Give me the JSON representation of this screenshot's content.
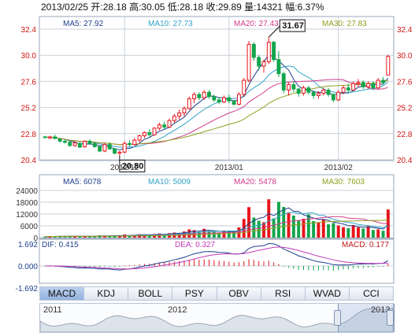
{
  "header": {
    "summary": "2013/02/25 开:28.18 高:30.05 低:28.18 收:29.89 量:14321 幅:6.37%"
  },
  "price_legend": [
    {
      "label": "MA5: 27.92",
      "color": "#1f3f8c"
    },
    {
      "label": "MA10: 27.73",
      "color": "#31a3c6"
    },
    {
      "label": "MA20: 27.43",
      "color": "#d23c8c"
    },
    {
      "label": "MA30: 27.83",
      "color": "#8fa020"
    }
  ],
  "volume_legend": [
    {
      "label": "MA5: 6078",
      "color": "#1f3f8c"
    },
    {
      "label": "MA10: 5009",
      "color": "#31a3c6"
    },
    {
      "label": "MA20: 5478",
      "color": "#d23c8c"
    },
    {
      "label": "MA30: 7603",
      "color": "#8fa020"
    }
  ],
  "macd_legend": {
    "dif": "DIF: 0.415",
    "dea": "DEA: 0.327",
    "macd": "MACD: 0.177"
  },
  "price_axis": {
    "ticks": [
      "32.4",
      "30.0",
      "27.6",
      "25.2",
      "22.8",
      "20.4"
    ],
    "values": [
      32.4,
      30.0,
      27.6,
      25.2,
      22.8,
      20.4
    ]
  },
  "volume_axis": {
    "ticks": [
      "24000",
      "18000",
      "12000",
      "6000",
      "0"
    ],
    "values": [
      24000,
      18000,
      12000,
      6000,
      0
    ]
  },
  "macd_axis": {
    "ticks": [
      "1.692",
      "0.000",
      "-1.692"
    ],
    "values": [
      1.692,
      0,
      -1.692
    ]
  },
  "date_labels": [
    "2012/12",
    "2013/01",
    "2013/02"
  ],
  "annotations": {
    "high": "31.67",
    "low": "20.80"
  },
  "tabs": [
    "MACD",
    "KDJ",
    "BOLL",
    "PSY",
    "OBV",
    "RSI",
    "WVAD",
    "CCI"
  ],
  "active_tab": "MACD",
  "navigator": {
    "years": [
      "2011",
      "2012",
      "2013"
    ]
  },
  "colors": {
    "up": "#e8141a",
    "down": "#13a54b",
    "grid": "#c9d0d8",
    "axis_up": "#d01515"
  },
  "chart_data": {
    "type": "candlestick",
    "title": "",
    "date_range": [
      "2012-11-16",
      "2013-02-25"
    ],
    "ylim_price": [
      20.4,
      32.4
    ],
    "ylim_volume": [
      0,
      24000
    ],
    "ylim_macd": [
      -1.692,
      1.692
    ],
    "candles": [
      [
        22.5,
        22.6,
        22.4,
        22.45
      ],
      [
        22.4,
        22.6,
        22.3,
        22.5
      ],
      [
        22.5,
        22.7,
        22.3,
        22.35
      ],
      [
        22.3,
        22.4,
        22.0,
        22.1
      ],
      [
        22.1,
        22.3,
        21.9,
        22.0
      ],
      [
        22.0,
        22.1,
        21.6,
        21.7
      ],
      [
        21.7,
        22.1,
        21.6,
        21.95
      ],
      [
        21.9,
        22.0,
        21.5,
        21.55
      ],
      [
        21.6,
        22.2,
        21.5,
        22.1
      ],
      [
        22.1,
        22.3,
        21.8,
        21.9
      ],
      [
        21.9,
        22.0,
        21.5,
        21.6
      ],
      [
        21.6,
        21.7,
        21.1,
        21.2
      ],
      [
        21.2,
        21.9,
        21.1,
        21.8
      ],
      [
        21.8,
        22.0,
        21.3,
        21.4
      ],
      [
        21.4,
        21.5,
        20.9,
        21.0
      ],
      [
        21.0,
        21.2,
        20.8,
        21.1
      ],
      [
        21.1,
        22.1,
        21.0,
        21.9
      ],
      [
        21.9,
        22.2,
        21.6,
        21.8
      ],
      [
        21.8,
        22.4,
        21.7,
        22.2
      ],
      [
        22.2,
        22.7,
        22.0,
        22.6
      ],
      [
        22.6,
        23.0,
        22.4,
        22.9
      ],
      [
        22.9,
        23.2,
        22.5,
        22.7
      ],
      [
        22.7,
        23.4,
        22.6,
        23.3
      ],
      [
        23.3,
        23.8,
        23.1,
        23.6
      ],
      [
        23.6,
        23.9,
        23.2,
        23.4
      ],
      [
        23.4,
        24.2,
        23.3,
        24.0
      ],
      [
        24.0,
        24.6,
        23.8,
        24.4
      ],
      [
        24.4,
        25.0,
        24.1,
        24.7
      ],
      [
        24.7,
        25.3,
        24.4,
        25.1
      ],
      [
        25.1,
        26.2,
        25.0,
        26.0
      ],
      [
        26.0,
        26.6,
        25.6,
        26.4
      ],
      [
        26.4,
        26.6,
        25.9,
        26.1
      ],
      [
        26.1,
        26.8,
        25.9,
        26.6
      ],
      [
        26.6,
        26.8,
        26.0,
        26.2
      ],
      [
        26.2,
        26.4,
        25.7,
        25.9
      ],
      [
        25.9,
        26.1,
        25.5,
        25.7
      ],
      [
        25.7,
        26.3,
        25.6,
        26.1
      ],
      [
        26.1,
        26.4,
        25.6,
        25.8
      ],
      [
        25.8,
        25.9,
        25.4,
        25.5
      ],
      [
        25.5,
        26.6,
        25.4,
        26.4
      ],
      [
        26.4,
        27.9,
        26.2,
        27.7
      ],
      [
        27.7,
        31.3,
        27.5,
        31.0
      ],
      [
        31.0,
        31.2,
        29.5,
        29.8
      ],
      [
        29.8,
        30.0,
        28.6,
        29.0
      ],
      [
        29.0,
        29.6,
        28.4,
        29.4
      ],
      [
        29.4,
        31.67,
        29.2,
        31.2
      ],
      [
        31.2,
        31.3,
        29.4,
        29.6
      ],
      [
        29.6,
        30.4,
        28.0,
        28.3
      ],
      [
        28.3,
        28.5,
        26.5,
        26.8
      ],
      [
        26.8,
        27.5,
        26.3,
        27.3
      ],
      [
        27.3,
        27.6,
        26.6,
        26.9
      ],
      [
        26.9,
        27.0,
        26.2,
        26.5
      ],
      [
        26.5,
        27.2,
        26.3,
        27.0
      ],
      [
        27.0,
        27.2,
        26.4,
        26.6
      ],
      [
        26.6,
        26.8,
        26.0,
        26.3
      ],
      [
        26.3,
        26.7,
        26.0,
        26.5
      ],
      [
        26.5,
        27.0,
        26.3,
        26.8
      ],
      [
        26.8,
        27.0,
        26.2,
        26.4
      ],
      [
        26.4,
        26.5,
        25.7,
        25.9
      ],
      [
        25.9,
        26.8,
        25.8,
        26.6
      ],
      [
        26.6,
        27.2,
        26.4,
        27.0
      ],
      [
        27.0,
        27.4,
        26.6,
        26.8
      ],
      [
        26.8,
        27.6,
        26.7,
        27.4
      ],
      [
        27.4,
        27.8,
        27.1,
        27.5
      ],
      [
        27.5,
        27.7,
        26.9,
        27.1
      ],
      [
        27.1,
        27.6,
        26.9,
        27.4
      ],
      [
        27.4,
        27.6,
        26.8,
        27.0
      ],
      [
        27.0,
        27.9,
        26.9,
        27.7
      ],
      [
        27.7,
        28.0,
        27.3,
        27.5
      ],
      [
        28.18,
        30.05,
        28.18,
        29.89
      ]
    ],
    "volume": [
      500,
      700,
      600,
      800,
      700,
      900,
      600,
      700,
      800,
      600,
      900,
      1200,
      1000,
      800,
      1100,
      900,
      1600,
      1200,
      1400,
      1700,
      1500,
      1300,
      1800,
      2100,
      1700,
      2300,
      2600,
      2400,
      3100,
      4200,
      3800,
      3000,
      4500,
      3300,
      2900,
      2600,
      3600,
      3100,
      2800,
      5200,
      9500,
      15500,
      10200,
      8600,
      7800,
      19500,
      9800,
      18200,
      15600,
      12500,
      11200,
      8900,
      9600,
      11800,
      8400,
      7600,
      9200,
      6800,
      7400,
      6200,
      5300,
      4800,
      6400,
      5200,
      4600,
      5800,
      3900,
      4200,
      3500,
      14321
    ],
    "macd_hist": [
      -0.05,
      -0.05,
      -0.06,
      -0.07,
      -0.08,
      -0.09,
      -0.08,
      -0.09,
      -0.07,
      -0.07,
      -0.08,
      -0.1,
      -0.06,
      -0.07,
      -0.08,
      -0.06,
      0.04,
      0.05,
      0.08,
      0.12,
      0.16,
      0.17,
      0.21,
      0.25,
      0.26,
      0.3,
      0.34,
      0.36,
      0.4,
      0.48,
      0.5,
      0.48,
      0.52,
      0.49,
      0.44,
      0.39,
      0.38,
      0.33,
      0.27,
      0.29,
      0.36,
      0.52,
      0.46,
      0.38,
      0.35,
      0.4,
      0.28,
      0.14,
      -0.06,
      -0.14,
      -0.22,
      -0.28,
      -0.3,
      -0.33,
      -0.36,
      -0.35,
      -0.33,
      -0.34,
      -0.38,
      -0.33,
      -0.27,
      -0.25,
      -0.2,
      -0.17,
      -0.16,
      -0.12,
      -0.11,
      -0.06,
      -0.05,
      0.18
    ]
  }
}
